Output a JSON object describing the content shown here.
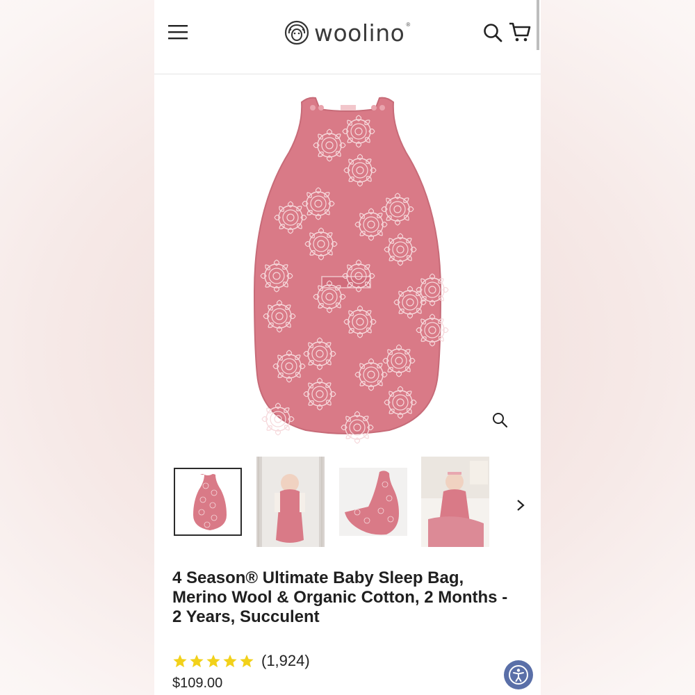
{
  "header": {
    "logo_text": "woolino",
    "logo_mark": "®",
    "menu_icon": "hamburger-icon",
    "search_icon": "search-icon",
    "cart_icon": "cart-icon"
  },
  "product": {
    "title": "4 Season® Ultimate Baby Sleep Bag, Merino Wool & Organic Cotton, 2 Months - 2 Years, Succulent",
    "rating_value": 5,
    "review_count": "(1,924)",
    "price": "$109.00"
  },
  "gallery": {
    "thumbnails": [
      "flat-front",
      "baby-in-crib",
      "side-view",
      "baby-on-bed"
    ],
    "active_index": 0,
    "zoom_icon": "zoom-icon",
    "next_icon": "chevron-right-icon"
  },
  "colors": {
    "bag_pink": "#d97a87",
    "flower_line": "#f6d9dc",
    "star": "#f2d11a",
    "accessibility": "#5a6fa8"
  }
}
